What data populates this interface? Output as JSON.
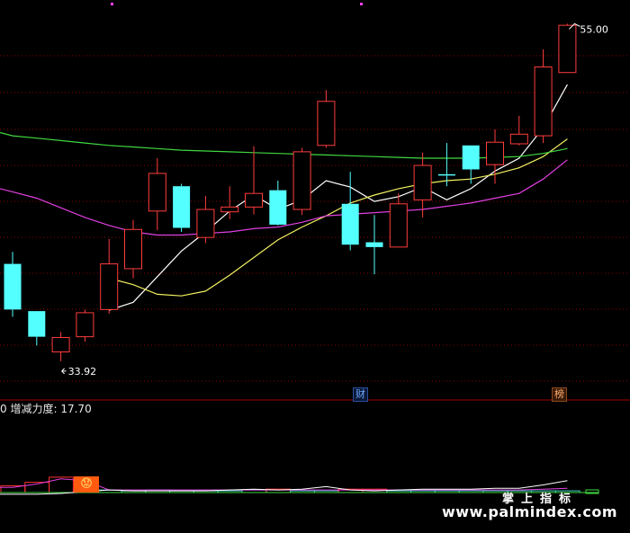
{
  "chart_data": {
    "type": "candlestick",
    "ylim": [
      31.5,
      56.2
    ],
    "high_label": "55.00",
    "low_label": "33.92",
    "candles": [
      {
        "o": 40.0,
        "h": 40.75,
        "l": 36.7,
        "c": 37.15
      },
      {
        "o": 37.05,
        "h": 37.05,
        "l": 34.9,
        "c": 35.45
      },
      {
        "o": 34.5,
        "h": 35.75,
        "l": 33.92,
        "c": 35.4
      },
      {
        "o": 35.45,
        "h": 37.15,
        "l": 35.15,
        "c": 36.95
      },
      {
        "o": 37.15,
        "h": 41.55,
        "l": 36.9,
        "c": 40.0
      },
      {
        "o": 39.7,
        "h": 42.75,
        "l": 39.1,
        "c": 42.15
      },
      {
        "o": 43.3,
        "h": 46.6,
        "l": 42.1,
        "c": 45.65
      },
      {
        "o": 44.85,
        "h": 45.0,
        "l": 42.0,
        "c": 42.25
      },
      {
        "o": 41.65,
        "h": 44.25,
        "l": 41.3,
        "c": 43.4
      },
      {
        "o": 43.25,
        "h": 44.85,
        "l": 42.8,
        "c": 43.55
      },
      {
        "o": 43.55,
        "h": 47.35,
        "l": 43.1,
        "c": 44.4
      },
      {
        "o": 44.6,
        "h": 45.2,
        "l": 42.4,
        "c": 42.45
      },
      {
        "o": 43.4,
        "h": 47.25,
        "l": 43.05,
        "c": 47.0
      },
      {
        "o": 47.4,
        "h": 50.85,
        "l": 47.25,
        "c": 50.15
      },
      {
        "o": 43.75,
        "h": 45.75,
        "l": 40.85,
        "c": 41.2
      },
      {
        "o": 41.35,
        "h": 43.05,
        "l": 39.35,
        "c": 41.05
      },
      {
        "o": 41.05,
        "h": 44.4,
        "l": 41.05,
        "c": 43.75
      },
      {
        "o": 44.0,
        "h": 46.95,
        "l": 42.9,
        "c": 46.15
      },
      {
        "o": 45.6,
        "h": 47.55,
        "l": 44.85,
        "c": 45.55
      },
      {
        "o": 47.4,
        "h": 47.4,
        "l": 45.0,
        "c": 45.9
      },
      {
        "o": 46.2,
        "h": 48.4,
        "l": 45.0,
        "c": 47.6
      },
      {
        "o": 47.5,
        "h": 49.25,
        "l": 47.4,
        "c": 48.1
      },
      {
        "o": 48.0,
        "h": 53.4,
        "l": 47.55,
        "c": 52.3
      },
      {
        "o": 51.95,
        "h": 55.0,
        "l": 51.95,
        "c": 54.9
      }
    ],
    "ma_series": [
      {
        "color": "#ffffff",
        "values": [
          null,
          null,
          null,
          null,
          37.1,
          37.6,
          39.2,
          40.8,
          42.0,
          43.3,
          44.3,
          43.4,
          44.0,
          45.2,
          44.8,
          43.9,
          44.2,
          44.8,
          44.0,
          44.7,
          45.8,
          46.6,
          48.5,
          51.2
        ]
      },
      {
        "color": "#f0f060",
        "values": [
          null,
          null,
          null,
          null,
          39.1,
          38.7,
          38.1,
          38.0,
          38.3,
          39.3,
          40.4,
          41.5,
          42.3,
          43.0,
          43.8,
          44.3,
          44.7,
          45.0,
          45.2,
          45.3,
          45.6,
          46.0,
          46.7,
          47.8
        ]
      },
      {
        "color": "#40d840",
        "values": [
          48.0,
          47.85,
          47.7,
          47.55,
          47.4,
          47.3,
          47.2,
          47.1,
          47.05,
          47.0,
          46.95,
          46.9,
          46.85,
          46.8,
          46.75,
          46.7,
          46.65,
          46.6,
          46.6,
          46.6,
          46.65,
          46.7,
          46.9,
          47.2
        ]
      },
      {
        "color": "#e040e0",
        "values": [
          44.5,
          44.1,
          43.5,
          42.9,
          42.4,
          42.0,
          41.8,
          41.8,
          41.9,
          42.0,
          42.2,
          42.3,
          42.6,
          43.0,
          43.1,
          43.2,
          43.3,
          43.4,
          43.6,
          43.8,
          44.1,
          44.4,
          45.3,
          46.5
        ]
      }
    ],
    "indicator": {
      "name": "增减力度",
      "value": "17.70",
      "prefix": "0",
      "bars": [
        {
          "v": 8,
          "color": "#ff3030"
        },
        {
          "v": 12,
          "color": "#ff3030"
        },
        {
          "v": 18,
          "color": "#ff3030"
        },
        {
          "v": 5,
          "color": "#ff3030"
        },
        {
          "v": 3,
          "color": "#3fd0c0"
        },
        {
          "v": 2,
          "color": "#3fd0c0"
        },
        {
          "v": 3,
          "color": "#3fd0c0"
        },
        {
          "v": 2,
          "color": "#3fd0c0"
        },
        {
          "v": 2,
          "color": "#3fd0c0"
        },
        {
          "v": 2,
          "color": "#3fd0c0"
        },
        {
          "v": 3,
          "color": "#3fd0c0"
        },
        {
          "v": 4,
          "color": "#ff3030"
        },
        {
          "v": 2,
          "color": "#3fd0c0"
        },
        {
          "v": 2,
          "color": "#3fd0c0"
        },
        {
          "v": 4,
          "color": "#ff3030"
        },
        {
          "v": 4,
          "color": "#ff3030"
        },
        {
          "v": 2,
          "color": "#3fd0c0"
        },
        {
          "v": 2,
          "color": "#3fd0c0"
        },
        {
          "v": 2,
          "color": "#3fd0c0"
        },
        {
          "v": 2,
          "color": "#3fd0c0"
        },
        {
          "v": 2,
          "color": "#3fd0c0"
        },
        {
          "v": 2,
          "color": "#3fd0c0"
        },
        {
          "v": 2,
          "color": "#3fd0c0"
        },
        {
          "v": 2,
          "color": "#3fd0c0"
        }
      ],
      "lines": [
        {
          "color": "#e040e0",
          "values": [
            6,
            10,
            16,
            14,
            3,
            3,
            3,
            3,
            3,
            3,
            3,
            3,
            3,
            3,
            3,
            3,
            3,
            3,
            3,
            3,
            3,
            3,
            4,
            5
          ]
        },
        {
          "color": "#ffffff",
          "values": [
            -2,
            -2,
            -1,
            1,
            3,
            2,
            2,
            2,
            2,
            3,
            4,
            3,
            4,
            7,
            3,
            2,
            3,
            4,
            4,
            4,
            5,
            5,
            9,
            14
          ]
        }
      ]
    },
    "markers": {
      "cai": "财",
      "bang": "榜"
    }
  },
  "watermark": {
    "cn": "掌上指标",
    "url": "www.palmindex.com"
  },
  "emoji_label": "😟",
  "colors": {
    "up": "#ff3c3c",
    "down": "#54ffff",
    "grid": "#8b0000",
    "bg": "#000000"
  }
}
